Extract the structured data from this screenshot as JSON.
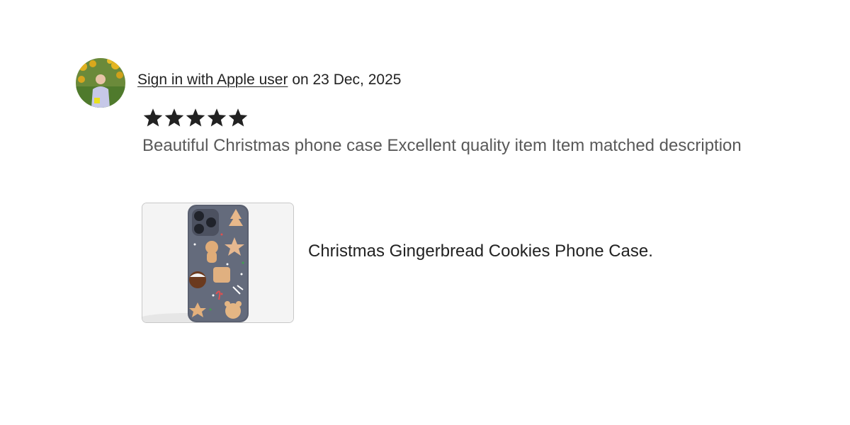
{
  "review": {
    "reviewer_name": "Sign in with Apple user",
    "date_text": "on 23 Dec, 2025",
    "rating": 5,
    "rating_max": 5,
    "text": "Beautiful Christmas phone case Excellent quality item Item matched description"
  },
  "item": {
    "title": "Christmas Gingerbread Cookies Phone Case."
  },
  "colors": {
    "text_primary": "#222222",
    "text_secondary": "#595959",
    "star": "#222222",
    "thumb_border": "#c8c8c8",
    "thumb_bg": "#f4f4f4"
  },
  "icons": {
    "star": "star-icon"
  }
}
